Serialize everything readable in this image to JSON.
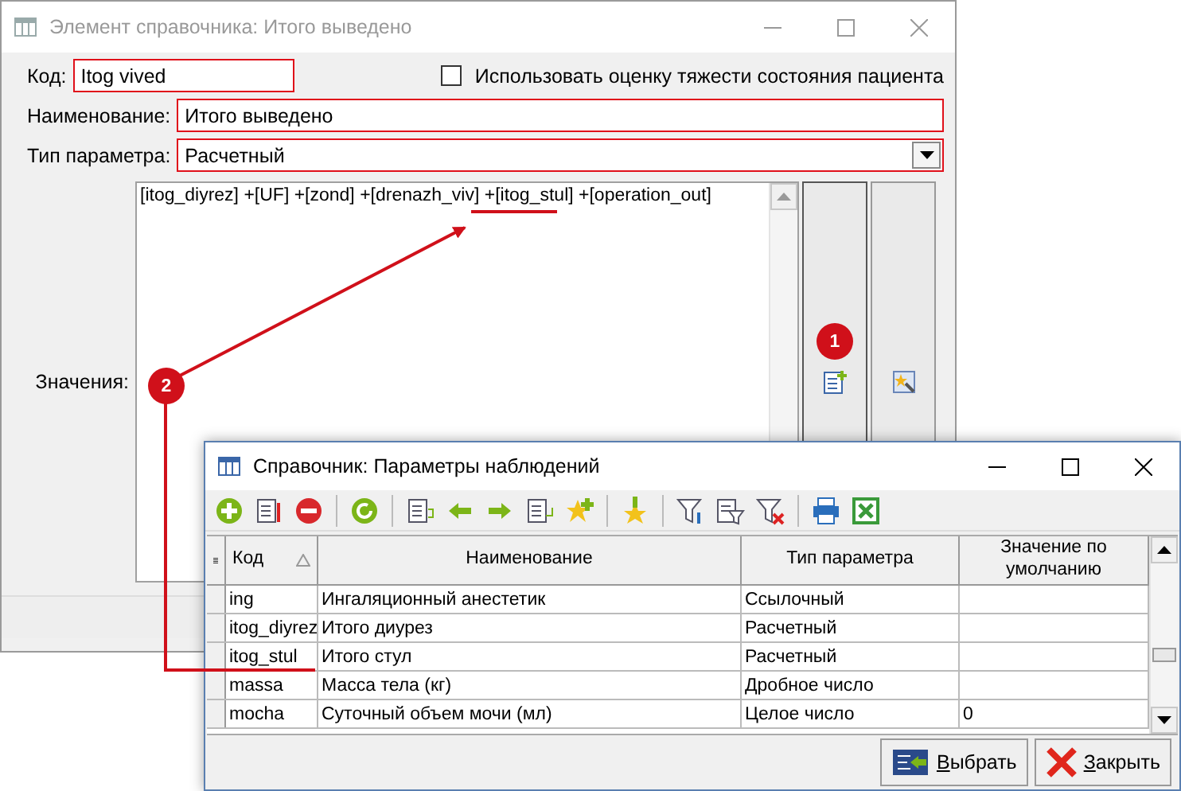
{
  "editor_window": {
    "title": "Элемент справочника: Итого выведено",
    "code": {
      "label": "Код:",
      "value": "Itog vived",
      "highlighted": true
    },
    "severity_checkbox": {
      "label": "Использовать оценку тяжести состояния пациента",
      "checked": false
    },
    "name": {
      "label": "Наименование:",
      "value": "Итого выведено",
      "highlighted": true
    },
    "param_type": {
      "label": "Тип параметра:",
      "value": "Расчетный",
      "highlighted": true
    },
    "values": {
      "label": "Значения:",
      "formula": "[itog_diyrez] +[UF] +[zond] +[drenazh_viv] +[itog_stul] +[operation_out]"
    }
  },
  "dictionary_window": {
    "title": "Справочник: Параметры наблюдений",
    "columns": [
      {
        "label": "Код",
        "sorted": true
      },
      {
        "label": "Наименование",
        "sorted": false
      },
      {
        "label": "Тип параметра",
        "sorted": false
      },
      {
        "label": "Значение по умолчанию",
        "sorted": false
      }
    ],
    "rows": [
      {
        "code": "ing",
        "name": "Ингаляционный анестетик",
        "type": "Ссылочный",
        "default": ""
      },
      {
        "code": "itog_diyrez",
        "name": "Итого диурез",
        "type": "Расчетный",
        "default": ""
      },
      {
        "code": "itog_stul",
        "name": "Итого стул",
        "type": "Расчетный",
        "default": ""
      },
      {
        "code": "massa",
        "name": "Масса тела (кг)",
        "type": "Дробное число",
        "default": ""
      },
      {
        "code": "mocha",
        "name": "Суточный объем мочи (мл)",
        "type": "Целое число",
        "default": "0"
      }
    ],
    "buttons": [
      {
        "label": "Выбрать",
        "kind": "select"
      },
      {
        "label": "Закрыть",
        "kind": "close"
      }
    ]
  },
  "annotations": {
    "badges": [
      {
        "label": "1"
      },
      {
        "label": "2"
      }
    ]
  }
}
